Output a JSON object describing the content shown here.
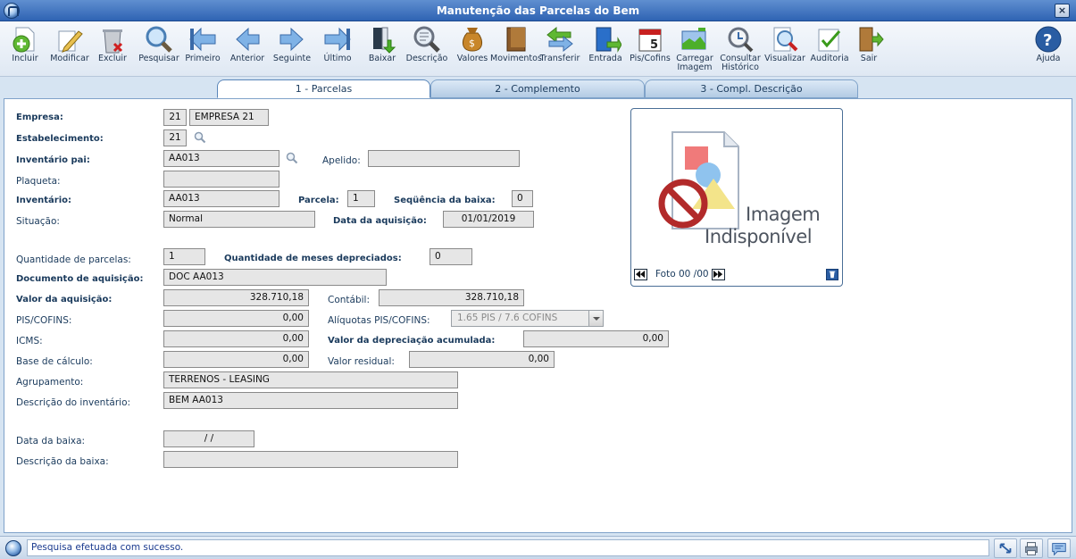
{
  "window": {
    "title": "Manutenção das Parcelas do Bem",
    "close": "×"
  },
  "toolbar": [
    {
      "label": "Incluir",
      "icon": "add-document-icon"
    },
    {
      "label": "Modificar",
      "icon": "edit-document-icon"
    },
    {
      "label": "Excluir",
      "icon": "trash-icon"
    },
    {
      "label": "Pesquisar",
      "icon": "magnifier-icon"
    },
    {
      "label": "Primeiro",
      "icon": "first-record-icon"
    },
    {
      "label": "Anterior",
      "icon": "previous-record-icon"
    },
    {
      "label": "Seguinte",
      "icon": "next-record-icon"
    },
    {
      "label": "Último",
      "icon": "last-record-icon"
    },
    {
      "label": "Baixar",
      "icon": "download-icon"
    },
    {
      "label": "Descrição",
      "icon": "description-icon"
    },
    {
      "label": "Valores",
      "icon": "money-bag-icon"
    },
    {
      "label": "Movimentos",
      "icon": "book-icon"
    },
    {
      "label": "Transferir",
      "icon": "transfer-arrows-icon"
    },
    {
      "label": "Entrada",
      "icon": "entry-book-icon"
    },
    {
      "label": "Pis/Cofins",
      "icon": "calendar-icon"
    },
    {
      "label": "Carregar\nImagem",
      "icon": "load-image-icon"
    },
    {
      "label": "Consultar\nHistórico",
      "icon": "history-search-icon"
    },
    {
      "label": "Visualizar",
      "icon": "preview-icon"
    },
    {
      "label": "Auditoria",
      "icon": "audit-checklist-icon"
    },
    {
      "label": "Sair",
      "icon": "exit-door-icon"
    },
    {
      "label": "Ajuda",
      "icon": "help-icon"
    }
  ],
  "tabs": [
    "1 - Parcelas",
    "2 - Complemento",
    "3 - Compl. Descrição"
  ],
  "form": {
    "empresa_label": "Empresa:",
    "empresa_code": "21",
    "empresa_name": "EMPRESA 21",
    "estab_label": "Estabelecimento:",
    "estab_code": "21",
    "inv_pai_label": "Inventário pai:",
    "inv_pai": "AA013",
    "apelido_label": "Apelido:",
    "apelido": "",
    "plaqueta_label": "Plaqueta:",
    "plaqueta": "",
    "inventario_label": "Inventário:",
    "inventario": "AA013",
    "parcela_label": "Parcela:",
    "parcela": "1",
    "seq_baixa_label": "Seqüência da baixa:",
    "seq_baixa": "0",
    "situacao_label": "Situação:",
    "situacao": "Normal",
    "data_aq_label": "Data da aquisição:",
    "data_aq": "01/01/2019",
    "qtd_parc_label": "Quantidade de parcelas:",
    "qtd_parc": "1",
    "qtd_meses_label": "Quantidade de meses depreciados:",
    "qtd_meses": "0",
    "doc_aq_label": "Documento de aquisição:",
    "doc_aq": "DOC AA013",
    "valor_aq_label": "Valor da aquisição:",
    "valor_aq": "328.710,18",
    "contabil_label": "Contábil:",
    "contabil": "328.710,18",
    "pis_label": "PIS/COFINS:",
    "pis": "0,00",
    "aliq_label": "Alíquotas PIS/COFINS:",
    "aliq": "1.65 PIS / 7.6 COFINS",
    "icms_label": "ICMS:",
    "icms": "0,00",
    "dep_acum_label": "Valor da depreciação acumulada:",
    "dep_acum": "0,00",
    "base_label": "Base de cálculo:",
    "base": "0,00",
    "residual_label": "Valor residual:",
    "residual": "0,00",
    "agrup_label": "Agrupamento:",
    "agrup": "TERRENOS - LEASING",
    "desc_inv_label": "Descrição do inventário:",
    "desc_inv": "BEM AA013",
    "data_baixa_label": "Data da baixa:",
    "data_baixa": "/ /",
    "desc_baixa_label": "Descrição da baixa:",
    "desc_baixa": ""
  },
  "photo": {
    "line1": "Imagem",
    "line2": "Indisponível",
    "counter": "Foto 00 /00"
  },
  "status": {
    "message": "Pesquisa efetuada com sucesso."
  }
}
